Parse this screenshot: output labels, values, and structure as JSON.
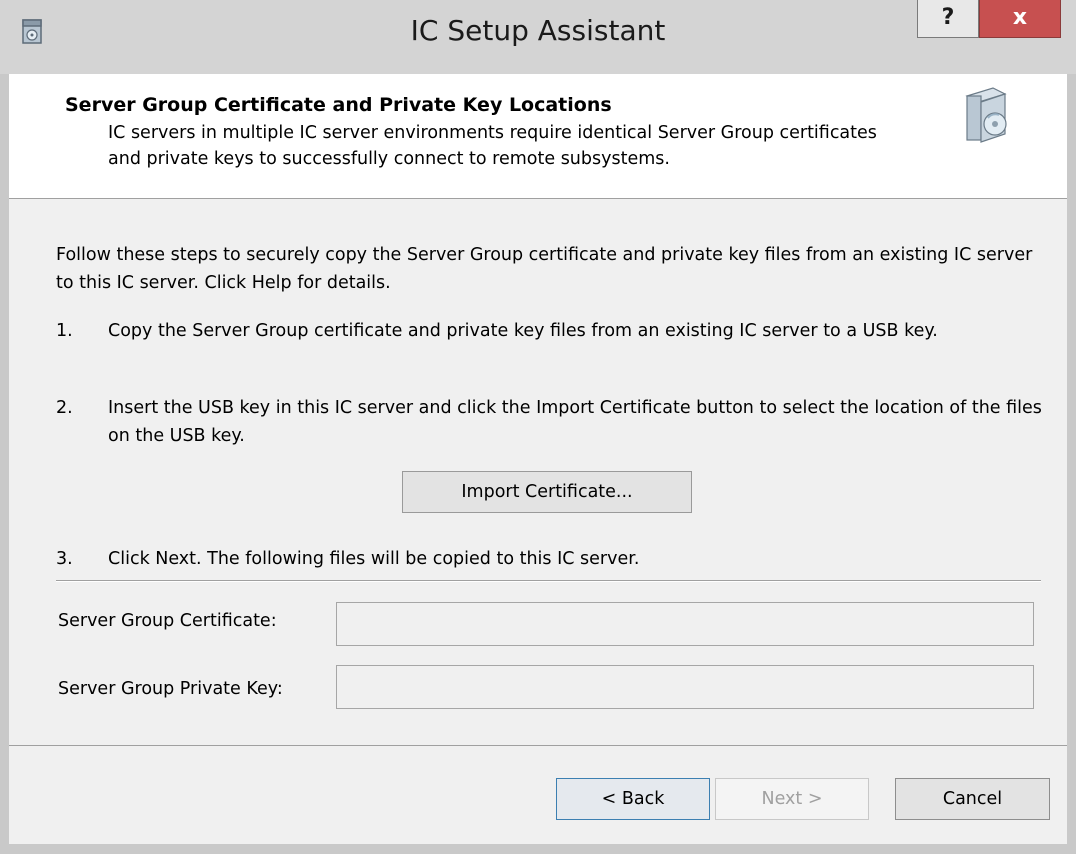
{
  "window": {
    "title": "IC Setup Assistant",
    "help_label": "?",
    "close_label": "x"
  },
  "header": {
    "title": "Server Group Certificate and Private Key Locations",
    "description": "IC servers in multiple IC server environments require identical Server Group certificates and private keys to successfully connect to remote subsystems."
  },
  "body": {
    "intro": "Follow these steps to securely copy the Server Group certificate and private key files from an existing IC server to this IC server. Click Help for details.",
    "steps": [
      {
        "number": "1.",
        "text": "Copy the Server Group certificate and private key files from an existing IC server to a USB key."
      },
      {
        "number": "2.",
        "text": "Insert the USB key in this IC server and click the Import Certificate button to select the location of the files on the USB key."
      },
      {
        "number": "3.",
        "text": "Click Next. The following files will be copied to this IC server."
      }
    ],
    "import_button_label": "Import Certificate...",
    "fields": {
      "certificate_label": "Server Group Certificate:",
      "certificate_value": "",
      "private_key_label": "Server Group Private Key:",
      "private_key_value": ""
    }
  },
  "footer": {
    "back_label": "< Back",
    "next_label": "Next >",
    "cancel_label": "Cancel"
  },
  "colors": {
    "close_button": "#c75050",
    "titlebar": "#d4d4d4",
    "body_background": "#f0f0f0",
    "focused_button_border": "#3c7fb1",
    "disabled_text": "#a0a0a0"
  },
  "icons": {
    "title_icon": "setup-wizard-icon",
    "header_icon": "software-box-cd-icon"
  }
}
